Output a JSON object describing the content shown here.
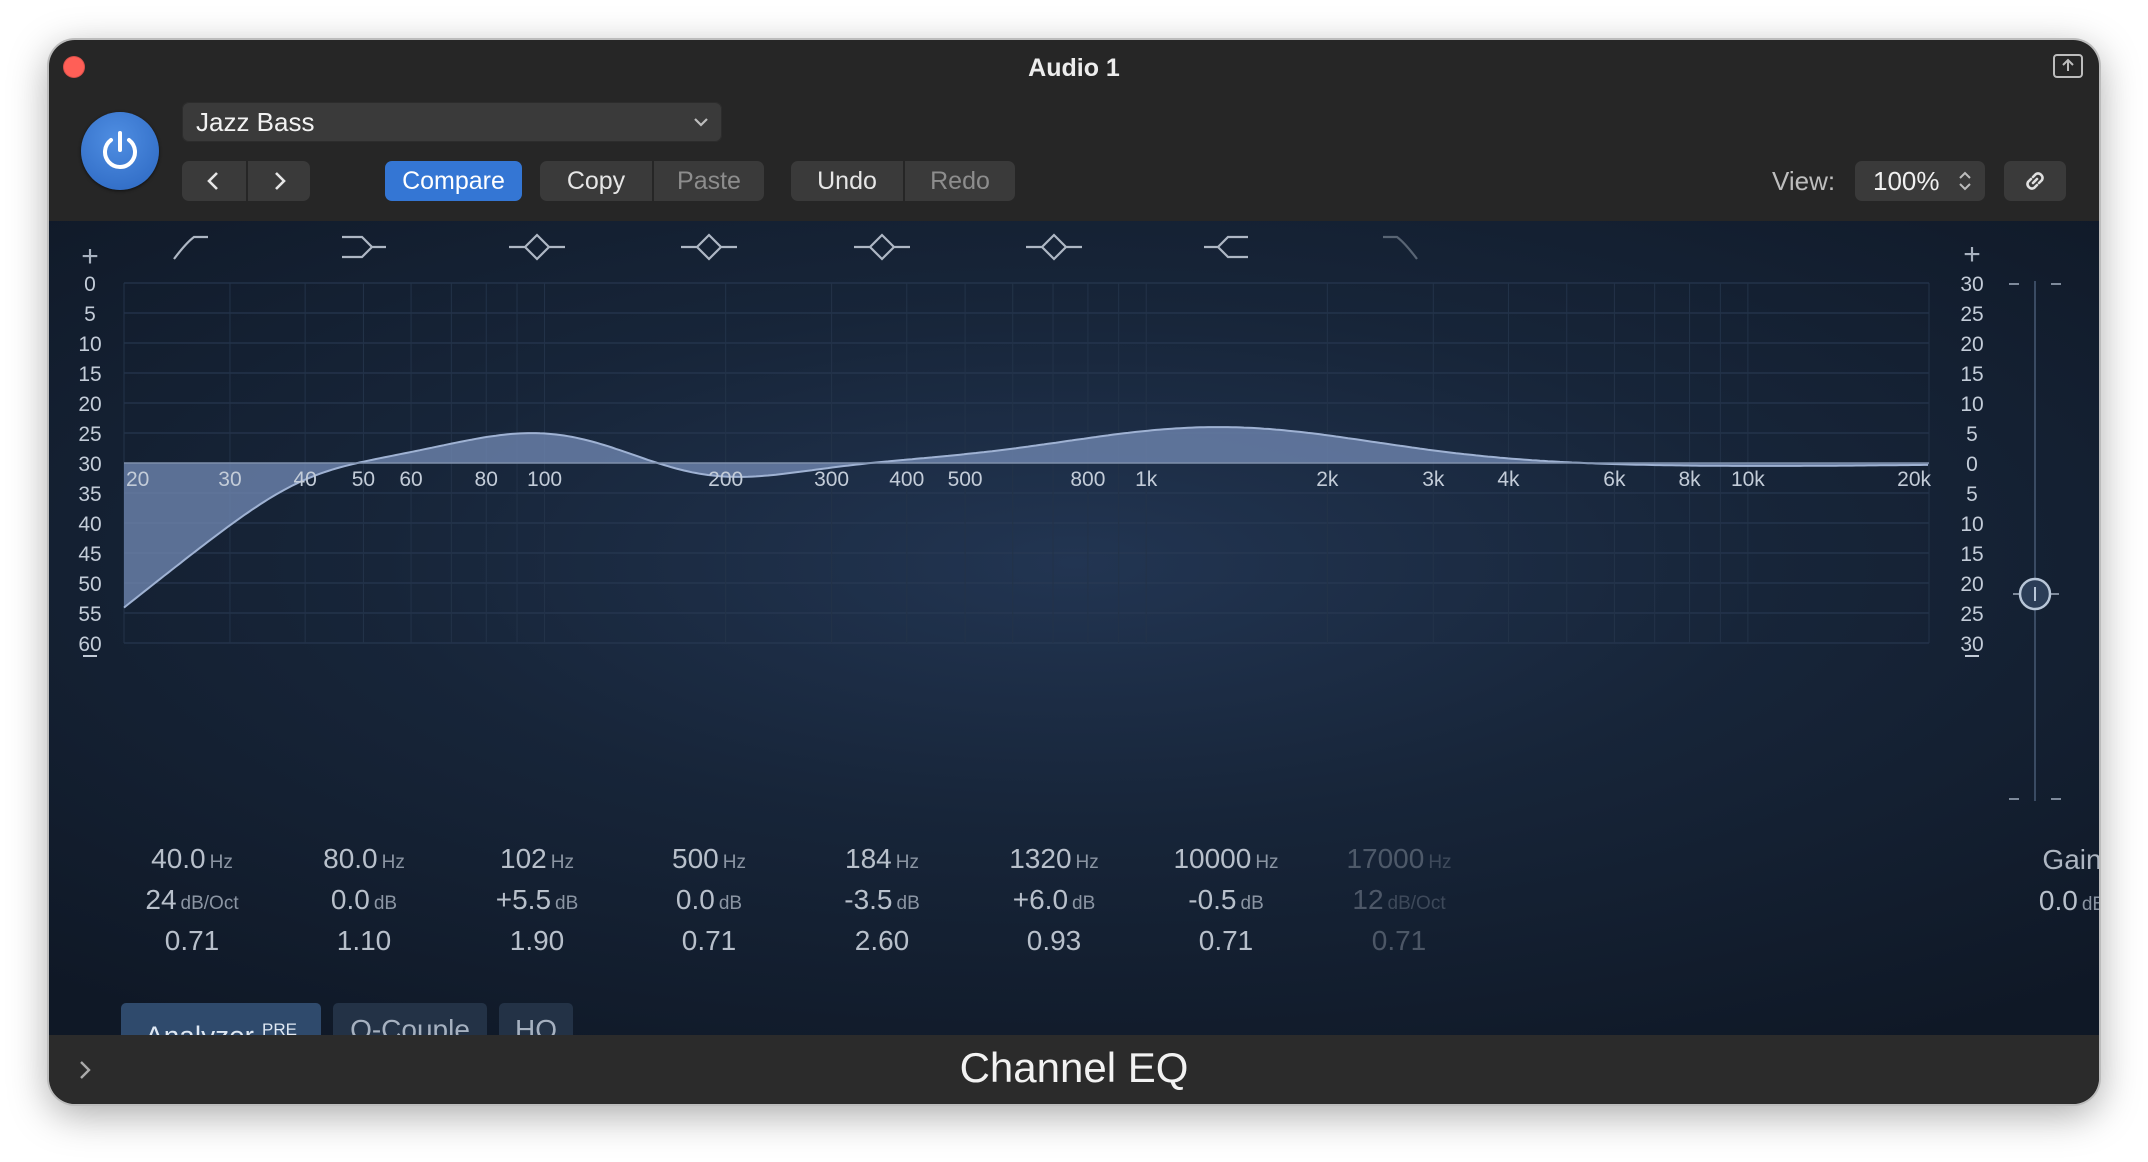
{
  "window": {
    "title": "Audio 1"
  },
  "header": {
    "preset_name": "Jazz Bass",
    "compare_label": "Compare",
    "copy_label": "Copy",
    "paste_label": "Paste",
    "undo_label": "Undo",
    "redo_label": "Redo",
    "view_label": "View:",
    "view_value": "100%"
  },
  "colors": {
    "accent": "#3476d4",
    "power": "#2e6bc6",
    "close": "#ff5f57",
    "curve_fill": "#6f87b1"
  },
  "graph": {
    "left_scale": [
      "0",
      "5",
      "10",
      "15",
      "20",
      "25",
      "30",
      "35",
      "40",
      "45",
      "50",
      "55",
      "60"
    ],
    "right_scale": [
      "30",
      "25",
      "20",
      "15",
      "10",
      "5",
      "0",
      "5",
      "10",
      "15",
      "20",
      "25",
      "30"
    ],
    "freq_labels": [
      "20",
      "30",
      "40",
      "50",
      "60",
      "80",
      "100",
      "200",
      "300",
      "400",
      "500",
      "800",
      "1k",
      "2k",
      "3k",
      "4k",
      "6k",
      "8k",
      "10k",
      "20k"
    ],
    "freq_values": [
      20,
      30,
      40,
      50,
      60,
      80,
      100,
      200,
      300,
      400,
      500,
      800,
      1000,
      2000,
      3000,
      4000,
      6000,
      8000,
      10000,
      20000
    ],
    "plus_symbol": "+",
    "band_icons": [
      "highpass-icon",
      "lowshelf-icon",
      "bell-icon",
      "bell-icon",
      "bell-icon",
      "bell-icon",
      "highshelf-icon",
      "lowpass-icon"
    ]
  },
  "bands": [
    {
      "freq": "40.0",
      "freq_unit": "Hz",
      "gain": "24",
      "gain_unit": "dB/Oct",
      "q": "0.71",
      "enabled": true
    },
    {
      "freq": "80.0",
      "freq_unit": "Hz",
      "gain": "0.0",
      "gain_unit": "dB",
      "q": "1.10",
      "enabled": true
    },
    {
      "freq": "102",
      "freq_unit": "Hz",
      "gain": "+5.5",
      "gain_unit": "dB",
      "q": "1.90",
      "enabled": true
    },
    {
      "freq": "500",
      "freq_unit": "Hz",
      "gain": "0.0",
      "gain_unit": "dB",
      "q": "0.71",
      "enabled": true
    },
    {
      "freq": "184",
      "freq_unit": "Hz",
      "gain": "-3.5",
      "gain_unit": "dB",
      "q": "2.60",
      "enabled": true
    },
    {
      "freq": "1320",
      "freq_unit": "Hz",
      "gain": "+6.0",
      "gain_unit": "dB",
      "q": "0.93",
      "enabled": true
    },
    {
      "freq": "10000",
      "freq_unit": "Hz",
      "gain": "-0.5",
      "gain_unit": "dB",
      "q": "0.71",
      "enabled": true
    },
    {
      "freq": "17000",
      "freq_unit": "Hz",
      "gain": "12",
      "gain_unit": "dB/Oct",
      "q": "0.71",
      "enabled": false
    }
  ],
  "gain_control": {
    "label": "Gain",
    "value": "0.0",
    "unit": "dB"
  },
  "buttons": {
    "analyzer": "Analyzer",
    "analyzer_badge": "PRE",
    "qcouple": "Q-Couple",
    "hq": "HQ"
  },
  "footer": {
    "plugin_name": "Channel EQ"
  }
}
